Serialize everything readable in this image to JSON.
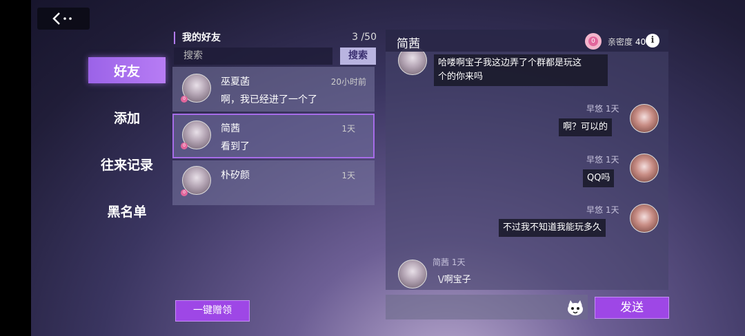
{
  "nav": {
    "back_icon": "back-arrow-icon",
    "items": [
      {
        "label": "好友",
        "active": true
      },
      {
        "label": "添加",
        "active": false
      },
      {
        "label": "往来记录",
        "active": false
      },
      {
        "label": "黑名单",
        "active": false
      }
    ]
  },
  "friends": {
    "title": "我的好友",
    "count": "3",
    "max": "/50",
    "search_placeholder": "搜索",
    "search_button": "搜索",
    "list": [
      {
        "name": "巫夏菡",
        "time": "20小时前",
        "message": "啊，我已经进了一个了",
        "heart": "0"
      },
      {
        "name": "简茜",
        "time": "1天",
        "message": "看到了",
        "heart": "0",
        "selected": true
      },
      {
        "name": "朴矽颜",
        "time": "1天",
        "message": "",
        "heart": "0"
      }
    ],
    "gift_button": "一键赠领"
  },
  "chat": {
    "title": "简茜",
    "intimacy_label": "亲密度",
    "intimacy_value": "40",
    "intimacy_heart": "0",
    "info": "i",
    "messages": [
      {
        "side": "left",
        "text_line1": "哈喽啊宝子我这边弄了个群都是玩这",
        "text_line2": "个的你来吗"
      },
      {
        "side": "right",
        "sender": "早悠",
        "time": "1天",
        "text": "啊？可以的"
      },
      {
        "side": "right",
        "sender": "早悠",
        "time": "1天",
        "text": "QQ吗"
      },
      {
        "side": "right",
        "sender": "早悠",
        "time": "1天",
        "text": "不过我不知道我能玩多久"
      },
      {
        "side": "left",
        "sender": "简茜",
        "time": "1天",
        "text": "\\/啊宝子"
      }
    ],
    "input_icon": "cat-emoji-icon",
    "send_button": "发送"
  },
  "colors": {
    "accent": "#9e47e6",
    "selected_border": "#a66ce8",
    "heart": "#e2669c"
  }
}
